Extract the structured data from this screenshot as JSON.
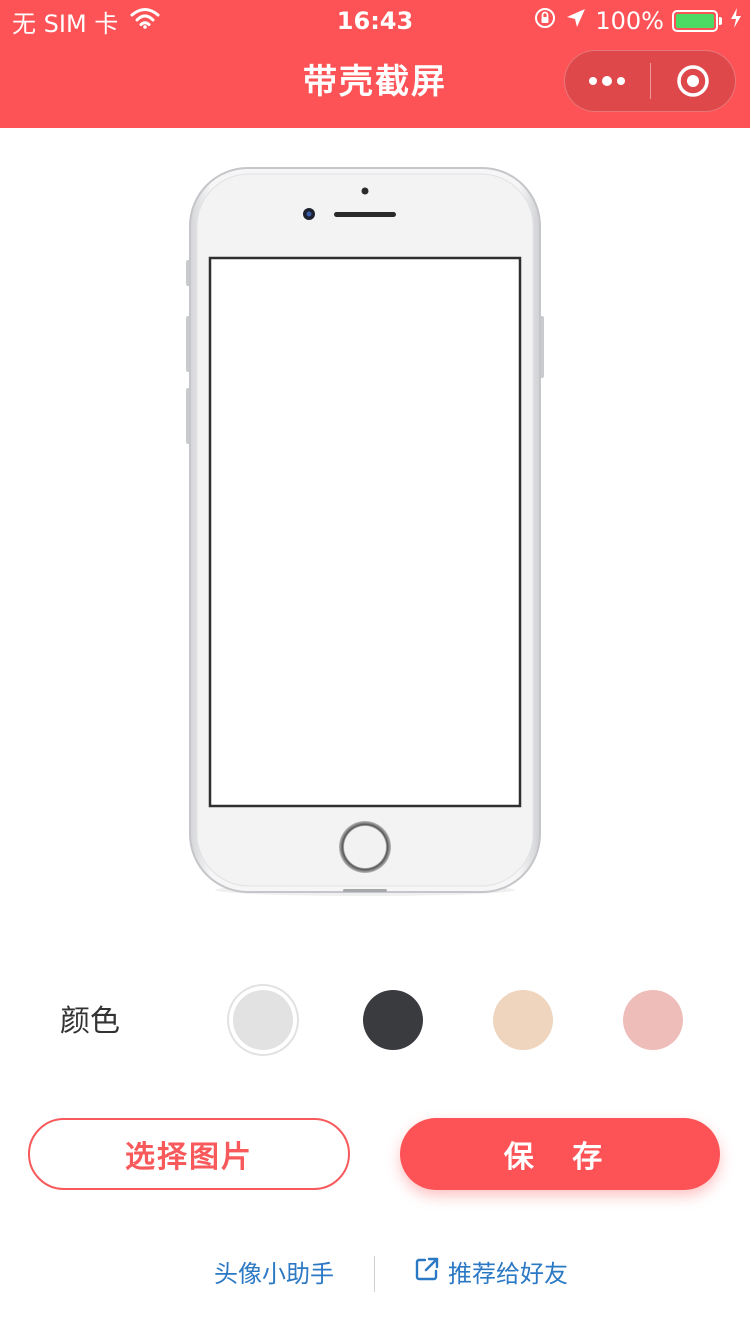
{
  "status_bar": {
    "carrier": "无 SIM 卡",
    "time": "16:43",
    "battery": "100%"
  },
  "nav": {
    "title": "带壳截屏"
  },
  "colors": {
    "label": "颜色",
    "options": [
      "#e2e2e2",
      "#3a3b3f",
      "#efd5bd",
      "#eebdb9"
    ],
    "selected_index": 0
  },
  "buttons": {
    "select_image": "选择图片",
    "save": "保 存"
  },
  "links": {
    "avatar_helper": "头像小助手",
    "recommend": "推荐给好友"
  },
  "theme": {
    "primary": "#fd5356",
    "link": "#2b78c4"
  }
}
